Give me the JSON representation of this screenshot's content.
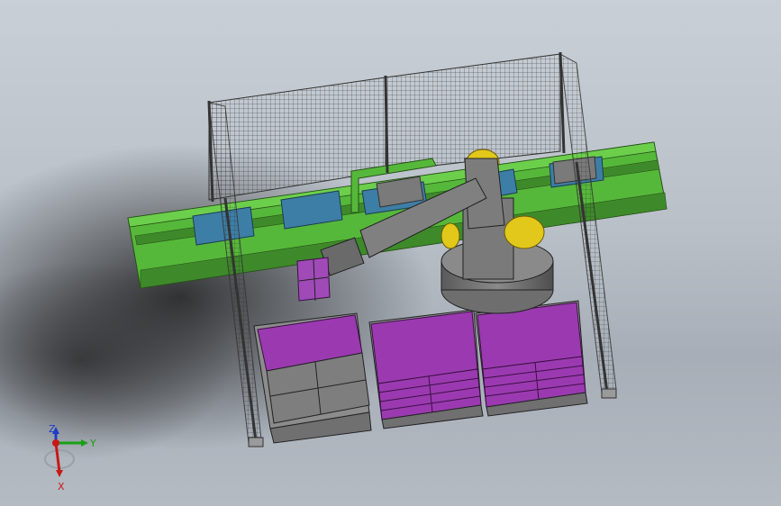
{
  "viewport": {
    "background": "#bcc3cb",
    "scene": "robot-palletizing-cell"
  },
  "colors": {
    "conveyor_green": "#56b83a",
    "conveyor_dark": "#3e8a2a",
    "guard_plate_blue": "#3d7ea6",
    "robot_gray": "#6e6e6e",
    "motor_yellow": "#e2c81a",
    "box_purple": "#9b3ab0",
    "pallet_gray": "#8c8c8c",
    "fence_mesh": "#2f2f2f"
  },
  "triad": {
    "z_label": "Z",
    "y_label": "Y",
    "x_label": "X",
    "z_color": "#1e3cc8",
    "y_color": "#18a018",
    "x_color": "#c81818"
  },
  "icons": {
    "triad": "coordinate-triad-icon"
  }
}
